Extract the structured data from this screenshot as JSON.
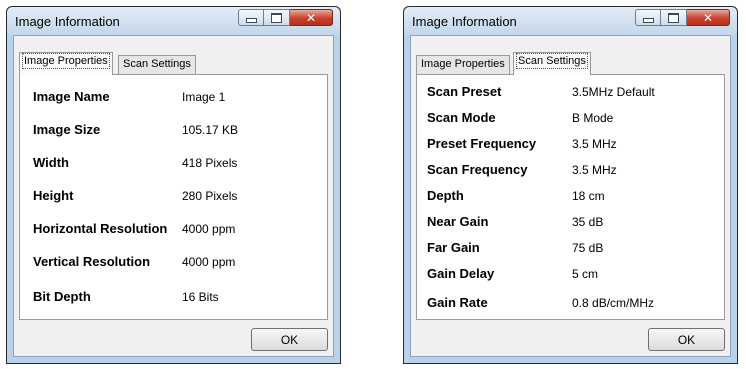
{
  "left_dialog": {
    "title": "Image Information",
    "tabs": [
      {
        "label": "Image Properties",
        "active": true
      },
      {
        "label": "Scan Settings",
        "active": false
      }
    ],
    "rows": [
      {
        "label": "Image Name",
        "value": "Image 1"
      },
      {
        "label": "Image Size",
        "value": "105.17 KB"
      },
      {
        "label": "Width",
        "value": "418 Pixels"
      },
      {
        "label": "Height",
        "value": "280 Pixels"
      },
      {
        "label": "Horizontal Resolution",
        "value": "4000 ppm"
      },
      {
        "label": "Vertical Resolution",
        "value": "4000 ppm"
      },
      {
        "label": "Bit Depth",
        "value": "16 Bits"
      }
    ],
    "ok_label": "OK"
  },
  "right_dialog": {
    "title": "Image Information",
    "tabs": [
      {
        "label": "Image Properties",
        "active": false
      },
      {
        "label": "Scan Settings",
        "active": true
      }
    ],
    "rows": [
      {
        "label": "Scan Preset",
        "value": "3.5MHz Default"
      },
      {
        "label": "Scan Mode",
        "value": "B Mode"
      },
      {
        "label": "Preset Frequency",
        "value": "3.5 MHz"
      },
      {
        "label": "Scan Frequency",
        "value": "3.5 MHz"
      },
      {
        "label": "Depth",
        "value": "18 cm"
      },
      {
        "label": "Near Gain",
        "value": "35 dB"
      },
      {
        "label": "Far Gain",
        "value": "75 dB"
      },
      {
        "label": "Gain Delay",
        "value": "5 cm"
      },
      {
        "label": "Gain Rate",
        "value": "0.8 dB/cm/MHz"
      }
    ],
    "ok_label": "OK"
  },
  "window_controls": [
    "minimize-icon",
    "maximize-icon",
    "close-icon"
  ],
  "colors": {
    "frame": "#b9d1ea",
    "close_button": "#c7432c",
    "panel": "#ffffff"
  }
}
